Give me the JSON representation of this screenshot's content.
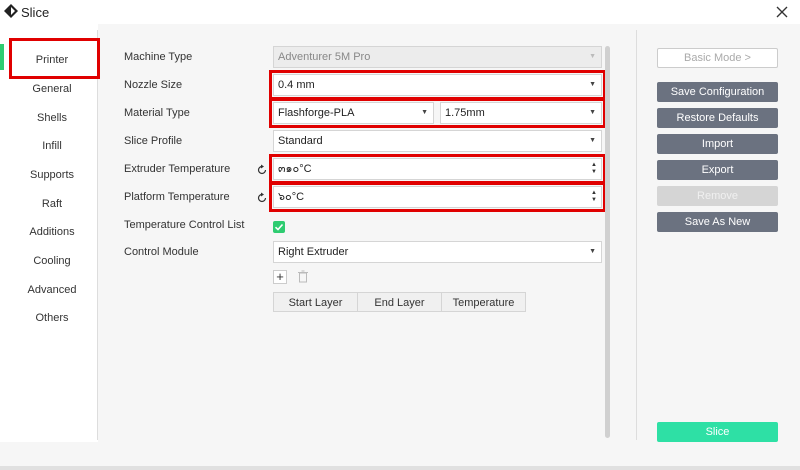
{
  "window": {
    "title": "Slice"
  },
  "sidebar": {
    "items": [
      {
        "label": "Printer"
      },
      {
        "label": "General"
      },
      {
        "label": "Shells"
      },
      {
        "label": "Infill"
      },
      {
        "label": "Supports"
      },
      {
        "label": "Raft"
      },
      {
        "label": "Additions"
      },
      {
        "label": "Cooling"
      },
      {
        "label": "Advanced"
      },
      {
        "label": "Others"
      }
    ]
  },
  "form": {
    "machine_type": {
      "label": "Machine Type",
      "value": "Adventurer 5M Pro"
    },
    "nozzle_size": {
      "label": "Nozzle Size",
      "value": "0.4 mm"
    },
    "material_type": {
      "label": "Material Type",
      "value": "Flashforge-PLA",
      "diameter": "1.75mm"
    },
    "slice_profile": {
      "label": "Slice Profile",
      "value": "Standard"
    },
    "extruder_temperature": {
      "label": "Extruder Temperature",
      "value": "๓๑๐°C"
    },
    "platform_temperature": {
      "label": "Platform Temperature",
      "value": "๖๐°C"
    },
    "temperature_control_list": {
      "label": "Temperature Control List",
      "checked": true
    },
    "control_module": {
      "label": "Control Module",
      "value": "Right Extruder"
    },
    "table": {
      "headers": [
        "Start Layer",
        "End Layer",
        "Temperature"
      ]
    }
  },
  "actions": {
    "basic_mode": "Basic Mode >",
    "save_configuration": "Save Configuration",
    "restore_defaults": "Restore Defaults",
    "import": "Import",
    "export": "Export",
    "remove": "Remove",
    "save_as_new": "Save As New",
    "slice": "Slice"
  },
  "icons": {
    "app": "app-diamond-icon",
    "close": "close-icon",
    "reset": "reset-icon",
    "add": "plus-icon",
    "delete": "trash-icon"
  },
  "colors": {
    "accent_green": "#2ecc71",
    "slice_button": "#2ee0a5",
    "action_button": "#6b7280",
    "highlight_red": "#e00000"
  }
}
